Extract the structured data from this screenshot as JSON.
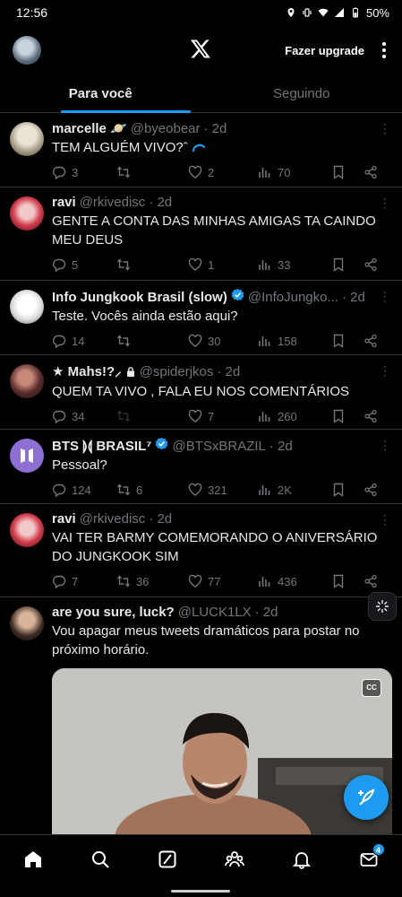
{
  "status_bar": {
    "time": "12:56",
    "battery": "50%"
  },
  "header": {
    "upgrade_label": "Fazer upgrade"
  },
  "tabs": [
    {
      "label": "Para você",
      "active": true
    },
    {
      "label": "Seguindo",
      "active": false
    }
  ],
  "tweets": [
    {
      "name": "marcelle 🪐",
      "handle": "@byeobear",
      "time": "· 2d",
      "text": "TEM ALGUÉM VIVO?ˆ",
      "replies": "3",
      "retweets": "",
      "likes": "2",
      "views": "70"
    },
    {
      "name": "ravi",
      "handle": "@rkivedisc",
      "time": "· 2d",
      "text": "GENTE A CONTA DAS MINHAS AMIGAS TA CAINDO MEU DEUS",
      "replies": "5",
      "retweets": "",
      "likes": "1",
      "views": "33"
    },
    {
      "name": "Info Jungkook Brasil (slow)",
      "handle": "@InfoJungko...",
      "time": "· 2d",
      "text": "Teste. Vocês ainda estão aqui?",
      "replies": "14",
      "retweets": "",
      "likes": "30",
      "views": "158"
    },
    {
      "name": "★ Mahs!?⸝",
      "handle": "@spiderjkos",
      "time": "· 2d",
      "text": "QUEM TA VIVO , FALA EU NOS COMENTÁRIOS",
      "replies": "34",
      "retweets": "",
      "likes": "7",
      "views": "260"
    },
    {
      "name": "BTS ⟭⟬ BRASIL⁷",
      "handle": "@BTSxBRAZIL",
      "time": "· 2d",
      "text": "Pessoal?",
      "replies": "124",
      "retweets": "6",
      "likes": "321",
      "views": "2K"
    },
    {
      "name": "ravi",
      "handle": "@rkivedisc",
      "time": "· 2d",
      "text": "VAI TER BARMY COMEMORANDO O ANIVERSÁRIO DO JUNGKOOK SIM",
      "replies": "7",
      "retweets": "36",
      "likes": "77",
      "views": "436"
    },
    {
      "name": "are you sure, luck?",
      "handle": "@LUCK1LX",
      "time": "· 2d",
      "text": "Vou apagar meus tweets dramáticos para postar no próximo horário."
    }
  ],
  "media": {
    "cc_label": "CC"
  },
  "bottom_nav": {
    "messages_badge": "4"
  },
  "colors": {
    "accent": "#1d9bf0",
    "background": "#000000",
    "muted": "#71767b"
  },
  "icons": [
    "x-logo-icon",
    "reply-icon",
    "retweet-icon",
    "like-icon",
    "views-icon",
    "bookmark-icon",
    "share-icon",
    "home-icon",
    "search-icon",
    "grok-icon",
    "communities-icon",
    "bell-icon",
    "mail-icon",
    "compose-icon"
  ]
}
